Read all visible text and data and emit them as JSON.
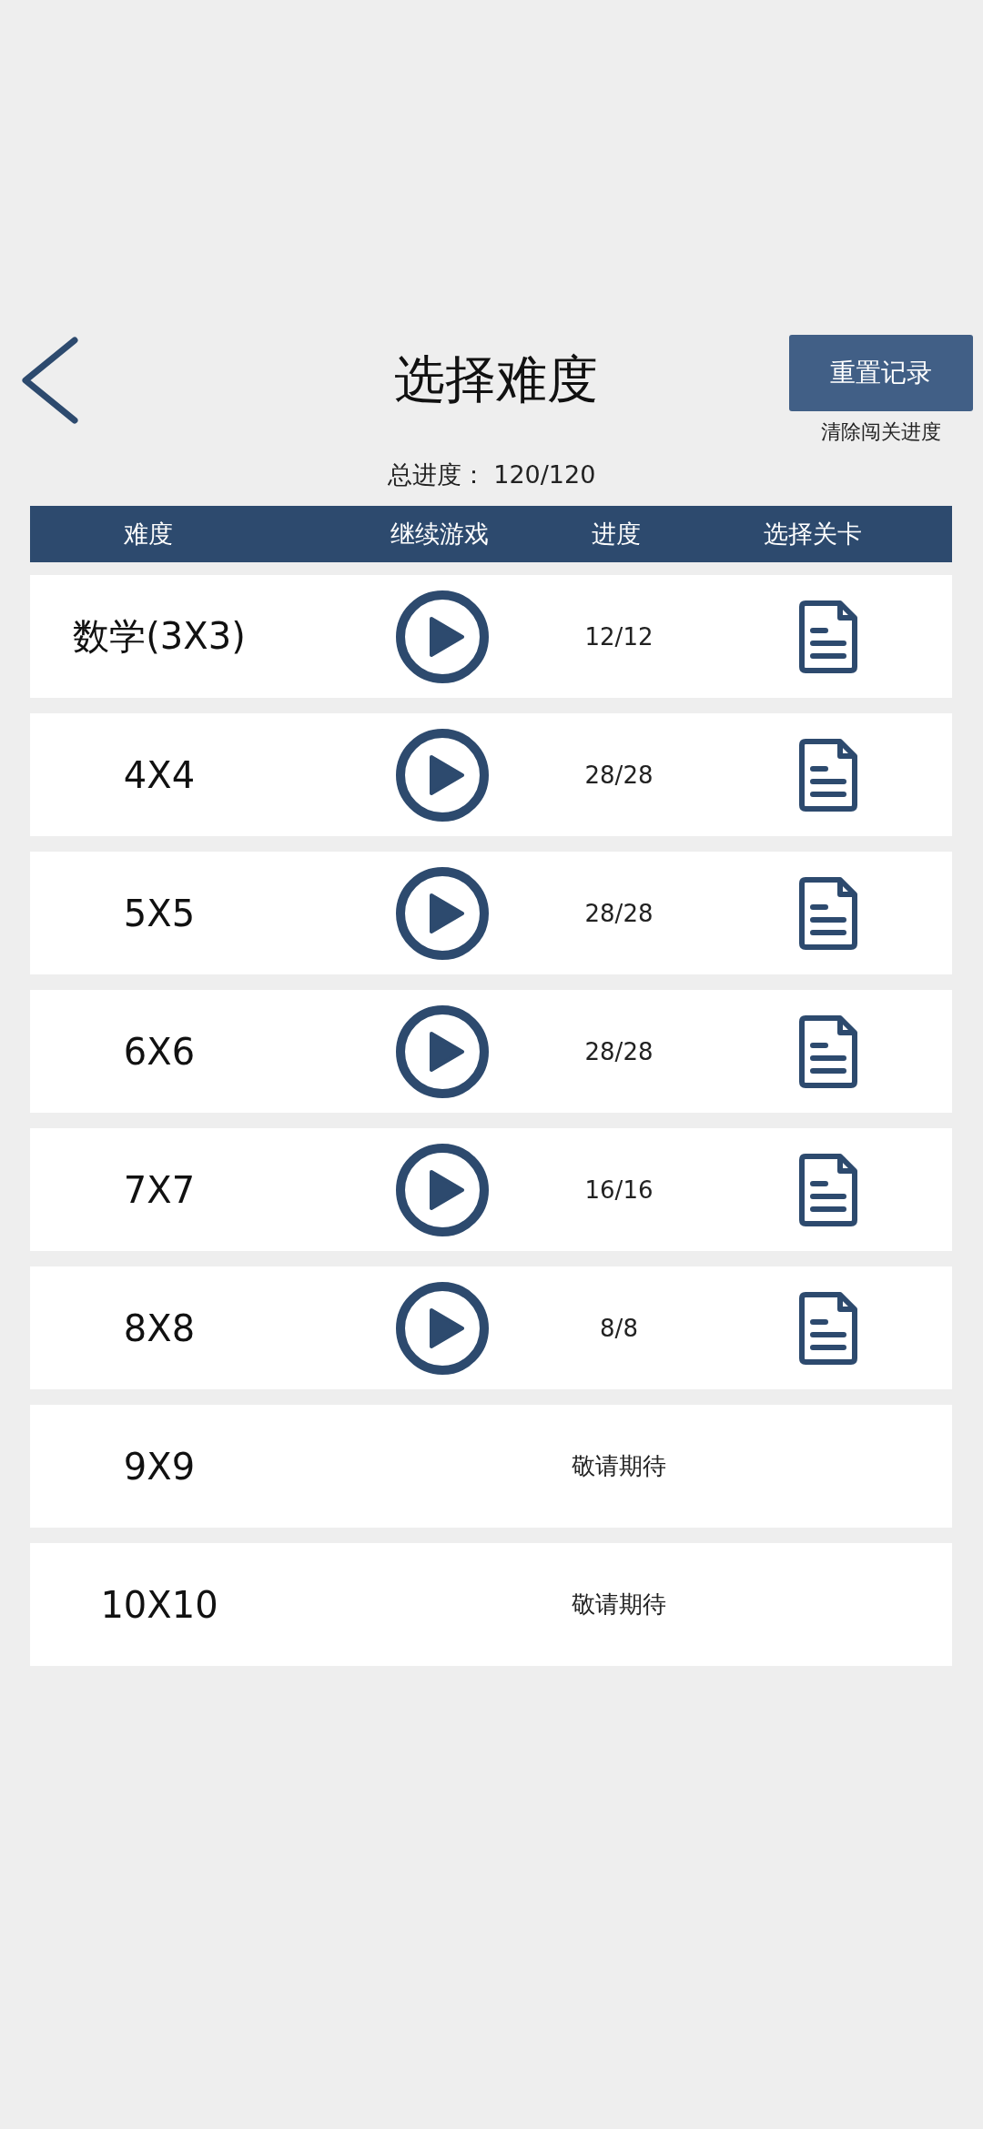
{
  "title": "选择难度",
  "reset": {
    "label": "重置记录",
    "hint": "清除闯关进度"
  },
  "total_progress": "总进度： 120/120",
  "columns": [
    "难度",
    "继续游戏",
    "进度",
    "选择关卡"
  ],
  "rows": [
    {
      "kind": "playable",
      "name": "数学(3X3)",
      "progress": "12/12"
    },
    {
      "kind": "playable",
      "name": "4X4",
      "progress": "28/28"
    },
    {
      "kind": "playable",
      "name": "5X5",
      "progress": "28/28"
    },
    {
      "kind": "playable",
      "name": "6X6",
      "progress": "28/28"
    },
    {
      "kind": "playable",
      "name": "7X7",
      "progress": "16/16"
    },
    {
      "kind": "playable",
      "name": "8X8",
      "progress": "8/8"
    },
    {
      "kind": "coming_soon",
      "name": "9X9",
      "note": "敬请期待"
    },
    {
      "kind": "coming_soon",
      "name": "10X10",
      "note": "敬请期待"
    }
  ]
}
